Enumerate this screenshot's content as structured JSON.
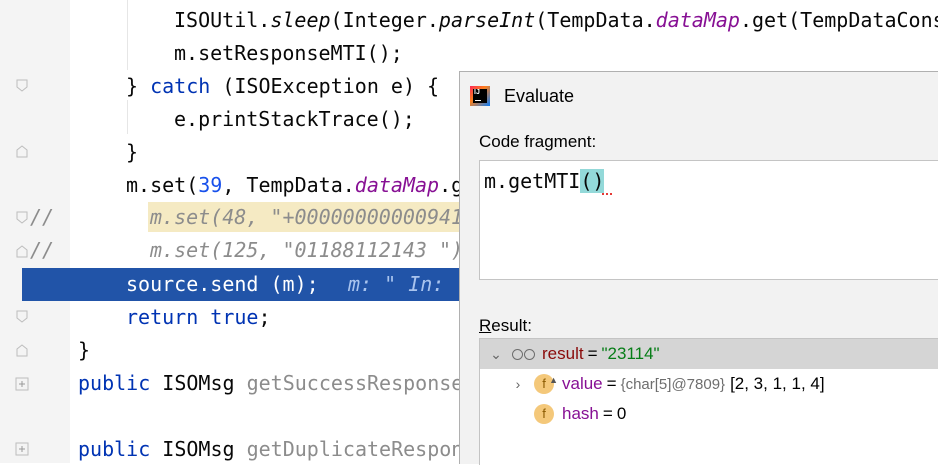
{
  "editor": {
    "lines": {
      "l1": {
        "method": "ISOUtil.",
        "sleep": "sleep",
        "rest1": "(Integer.",
        "parse": "parseInt",
        "rest2": "(TempData.",
        "datamap": "dataMap",
        "rest3": ".get(TempDataCons"
      },
      "l2": {
        "text": "m.setResponseMTI();"
      },
      "l3": {
        "brace": "} ",
        "catch_kw": "catch",
        "rest": " (ISOException e) {"
      },
      "l4": {
        "text": "e.printStackTrace();"
      },
      "l5": {
        "text": "}"
      },
      "l6": {
        "prefix": "m.set(",
        "num": "39",
        "mid": ", TempData.",
        "datamap": "dataMap",
        "rest": ".g"
      },
      "l7": {
        "comment": "//",
        "text": "m.set(48, \"+00000000000941"
      },
      "l8": {
        "comment": "//",
        "text": "m.set(125, \"01188112143 \")"
      },
      "l9": {
        "code": "source.send (m);",
        "inline": "m: \" In: ."
      },
      "l10": {
        "kw": "return",
        "val": " true",
        "semi": ";"
      },
      "l11": {
        "text": "}"
      },
      "l12": {
        "kw": "public",
        "type": " ISOMsg ",
        "name": "getSuccessResponse"
      },
      "l13": {
        "kw": "public",
        "type": " ISOMsg ",
        "name": "getDuplicateRespon"
      }
    }
  },
  "evaluate": {
    "title": "Evaluate",
    "logo_text": "IJ",
    "code_fragment_label": "Code fragment:",
    "code": {
      "before": "m.getMTI",
      "paren": "()"
    },
    "result_label_u": "R",
    "result_label_rest": "esult:",
    "tree": [
      {
        "chevron": "⌄",
        "name": "result",
        "eq": "=",
        "value": "\"23114\""
      },
      {
        "chevron": "›",
        "icon": "f",
        "name": "value",
        "eq": "=",
        "type": "{char[5]@7809}",
        "value": "[2, 3, 1, 1, 4]"
      },
      {
        "icon": "f",
        "name": "hash",
        "eq": "=",
        "value": "0"
      }
    ]
  }
}
